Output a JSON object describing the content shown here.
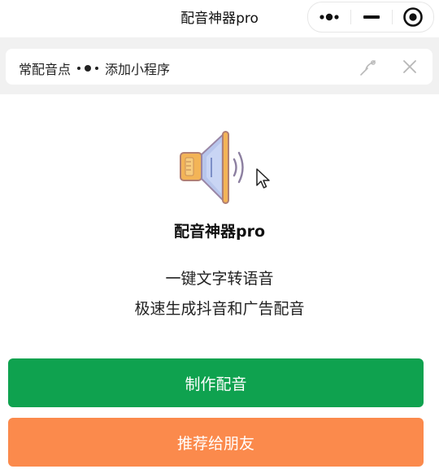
{
  "window": {
    "title": "配音神器pro"
  },
  "capsule": {
    "more_icon": "more-dots-icon",
    "minimize_icon": "minimize-icon",
    "close_icon": "record-close-icon"
  },
  "banner": {
    "text_before": "常配音点",
    "text_after": "添加小程序",
    "pin_icon": "pin-icon",
    "close_icon": "close-icon"
  },
  "hero": {
    "icon": "speaker-volume-icon",
    "app_name": "配音神器pro",
    "tagline_1": "一键文字转语音",
    "tagline_2": "极速生成抖音和广告配音"
  },
  "actions": {
    "make_label": "制作配音",
    "make_color": "#0fa24f",
    "share_label": "推荐给朋友",
    "share_color": "#fb8a4c"
  }
}
